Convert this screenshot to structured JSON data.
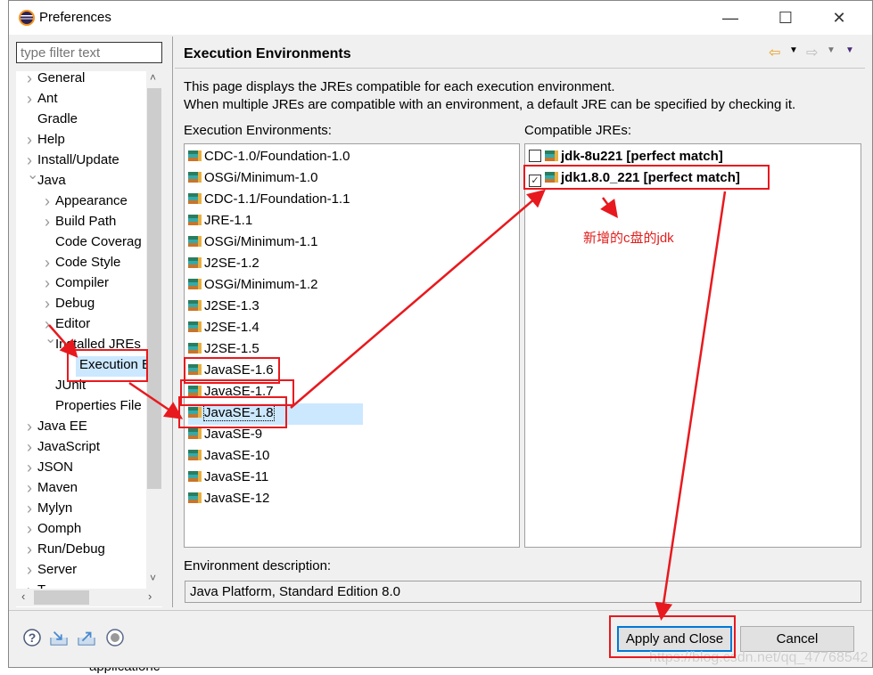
{
  "window": {
    "title": "Preferences",
    "minimize": "—",
    "maximize": "☐",
    "close": "✕"
  },
  "background": {
    "partial_label": "applicationc"
  },
  "filter": {
    "placeholder": "type filter text"
  },
  "tree": [
    {
      "label": "General",
      "level": 0,
      "chevron": "right"
    },
    {
      "label": "Ant",
      "level": 0,
      "chevron": "right"
    },
    {
      "label": "Gradle",
      "level": 0,
      "chevron": "none"
    },
    {
      "label": "Help",
      "level": 0,
      "chevron": "right"
    },
    {
      "label": "Install/Update",
      "level": 0,
      "chevron": "right"
    },
    {
      "label": "Java",
      "level": 0,
      "chevron": "down"
    },
    {
      "label": "Appearance",
      "level": 1,
      "chevron": "right"
    },
    {
      "label": "Build Path",
      "level": 1,
      "chevron": "right"
    },
    {
      "label": "Code Coverag",
      "level": 1,
      "chevron": "none"
    },
    {
      "label": "Code Style",
      "level": 1,
      "chevron": "right"
    },
    {
      "label": "Compiler",
      "level": 1,
      "chevron": "right"
    },
    {
      "label": "Debug",
      "level": 1,
      "chevron": "right"
    },
    {
      "label": "Editor",
      "level": 1,
      "chevron": "right"
    },
    {
      "label": "Installed JREs",
      "level": 1,
      "chevron": "down"
    },
    {
      "label": "Execution E",
      "level": 2,
      "chevron": "none",
      "selected": true
    },
    {
      "label": "JUnit",
      "level": 1,
      "chevron": "none"
    },
    {
      "label": "Properties File",
      "level": 1,
      "chevron": "none"
    },
    {
      "label": "Java EE",
      "level": 0,
      "chevron": "right"
    },
    {
      "label": "JavaScript",
      "level": 0,
      "chevron": "right"
    },
    {
      "label": "JSON",
      "level": 0,
      "chevron": "right"
    },
    {
      "label": "Maven",
      "level": 0,
      "chevron": "right"
    },
    {
      "label": "Mylyn",
      "level": 0,
      "chevron": "right"
    },
    {
      "label": "Oomph",
      "level": 0,
      "chevron": "right"
    },
    {
      "label": "Run/Debug",
      "level": 0,
      "chevron": "right"
    },
    {
      "label": "Server",
      "level": 0,
      "chevron": "right"
    },
    {
      "label": "T",
      "level": 0,
      "chevron": "right"
    }
  ],
  "page": {
    "title": "Execution Environments",
    "desc1": "This page displays the JREs compatible for each execution environment.",
    "desc2": "When multiple JREs are compatible with an environment, a default JRE can be specified by checking it.",
    "env_label": "Execution Environments:",
    "jre_label": "Compatible JREs:",
    "environments": [
      "CDC-1.0/Foundation-1.0",
      "OSGi/Minimum-1.0",
      "CDC-1.1/Foundation-1.1",
      "JRE-1.1",
      "OSGi/Minimum-1.1",
      "J2SE-1.2",
      "OSGi/Minimum-1.2",
      "J2SE-1.3",
      "J2SE-1.4",
      "J2SE-1.5",
      "JavaSE-1.6",
      "JavaSE-1.7",
      "JavaSE-1.8",
      "JavaSE-9",
      "JavaSE-10",
      "JavaSE-11",
      "JavaSE-12"
    ],
    "selected_environment": "JavaSE-1.8",
    "jres": [
      {
        "label": "jdk-8u221 [perfect match]",
        "checked": false
      },
      {
        "label": "jdk1.8.0_221 [perfect match]",
        "checked": true
      }
    ],
    "envdesc_label": "Environment description:",
    "envdesc_value": "Java Platform, Standard Edition 8.0"
  },
  "buttons": {
    "apply_close": "Apply and Close",
    "cancel": "Cancel"
  },
  "annotation": {
    "note": "新增的c盘的jdk",
    "color": "#e0201e"
  },
  "watermark": "https://blog.csdn.net/qq_47768542"
}
